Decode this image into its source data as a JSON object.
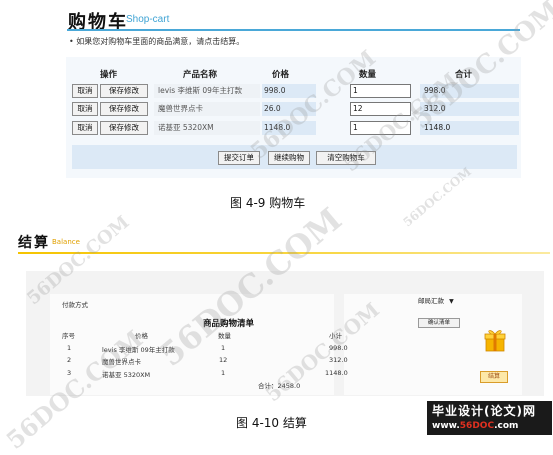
{
  "cart": {
    "title": "购物车",
    "subtitle": "Shop-cart",
    "notice": "• 如果您对购物车里面的商品满意，请点击结算。",
    "headers": {
      "action": "操作",
      "name": "产品名称",
      "price": "价格",
      "qty": "数量",
      "total": "合计"
    },
    "rows": [
      {
        "cancel": "取消",
        "save": "保存修改",
        "name": "levis 李维斯 09年主打款",
        "price": "998.0",
        "qty": "1",
        "total": "998.0"
      },
      {
        "cancel": "取消",
        "save": "保存修改",
        "name": "魔兽世界点卡",
        "price": "26.0",
        "qty": "12",
        "total": "312.0"
      },
      {
        "cancel": "取消",
        "save": "保存修改",
        "name": "诺基亚 5320XM",
        "price": "1148.0",
        "qty": "1",
        "total": "1148.0"
      }
    ],
    "buttons": {
      "submit": "提交订单",
      "continue": "继续购物",
      "clear": "清空购物车"
    },
    "caption": "图 4-9 购物车"
  },
  "checkout": {
    "title": "结算",
    "subtitle": "Balance",
    "payment_label": "付款方式",
    "payment_select": "邮局汇款",
    "confirm_button": "确认清单",
    "pay_button": "结算",
    "list_title": "商品购物清单",
    "headers": {
      "no": "序号",
      "price": "价格",
      "qty": "数量",
      "subtotal": "小计"
    },
    "rows": [
      {
        "no": "1",
        "name": "levis 李维斯 09年主打款",
        "qty": "1",
        "subtotal": "998.0"
      },
      {
        "no": "2",
        "name": "魔兽世界点卡",
        "qty": "12",
        "subtotal": "312.0"
      },
      {
        "no": "3",
        "name": "诺基亚 5320XM",
        "qty": "1",
        "subtotal": "1148.0"
      }
    ],
    "total": "合计：2458.0",
    "caption": "图 4-10 结算"
  },
  "watermark": "56DOC.COM",
  "logo": {
    "top": "毕业设计(论文)网",
    "bottom_left": "www.",
    "bottom_red": "56DOC",
    "bottom_right": ".com"
  }
}
